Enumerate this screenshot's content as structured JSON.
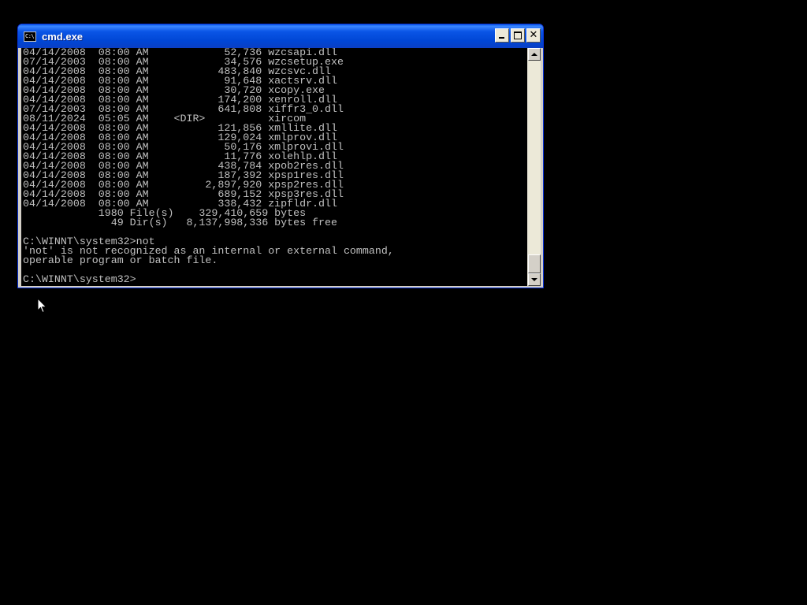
{
  "window": {
    "title": "cmd.exe",
    "icon_label": "C:\\",
    "close_label": "✕"
  },
  "console": {
    "lines": [
      "04/14/2008  08:00 AM            52,736 wzcsapi.dll",
      "07/14/2003  08:00 AM            34,576 wzcsetup.exe",
      "04/14/2008  08:00 AM           483,840 wzcsvc.dll",
      "04/14/2008  08:00 AM            91,648 xactsrv.dll",
      "04/14/2008  08:00 AM            30,720 xcopy.exe",
      "04/14/2008  08:00 AM           174,200 xenroll.dll",
      "07/14/2003  08:00 AM           641,808 xiffr3_0.dll",
      "08/11/2024  05:05 AM    <DIR>          xircom",
      "04/14/2008  08:00 AM           121,856 xmllite.dll",
      "04/14/2008  08:00 AM           129,024 xmlprov.dll",
      "04/14/2008  08:00 AM            50,176 xmlprovi.dll",
      "04/14/2008  08:00 AM            11,776 xolehlp.dll",
      "04/14/2008  08:00 AM           438,784 xpob2res.dll",
      "04/14/2008  08:00 AM           187,392 xpsp1res.dll",
      "04/14/2008  08:00 AM         2,897,920 xpsp2res.dll",
      "04/14/2008  08:00 AM           689,152 xpsp3res.dll",
      "04/14/2008  08:00 AM           338,432 zipfldr.dll",
      "            1980 File(s)    329,410,659 bytes",
      "              49 Dir(s)   8,137,998,336 bytes free",
      "",
      "C:\\WINNT\\system32>not",
      "'not' is not recognized as an internal or external command,",
      "operable program or batch file.",
      "",
      "C:\\WINNT\\system32>"
    ]
  },
  "colors": {
    "console_bg": "#000000",
    "console_fg": "#c0c0c0",
    "titlebar": "#0054e3",
    "desktop": "#000000"
  }
}
